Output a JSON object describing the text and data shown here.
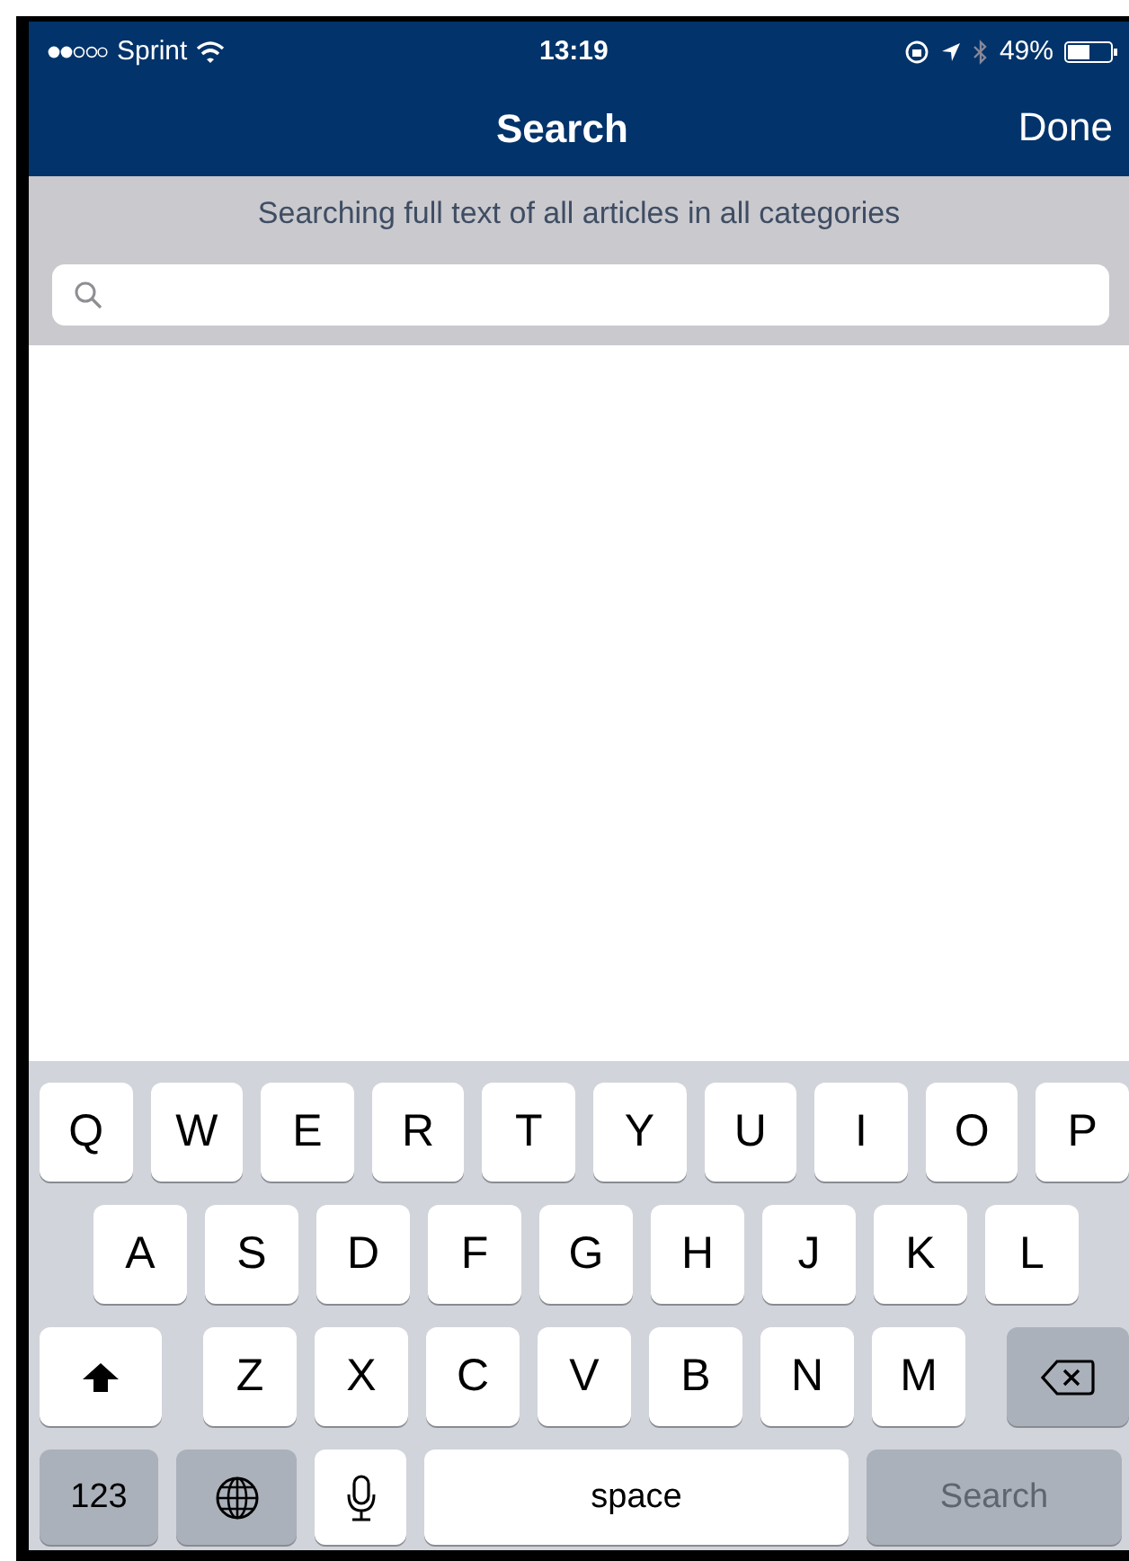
{
  "status_bar": {
    "carrier": "Sprint",
    "time": "13:19",
    "battery": "49%"
  },
  "nav_bar": {
    "title": "Search",
    "done": "Done"
  },
  "search_header": {
    "caption": "Searching full text of all articles in all categories"
  },
  "keyboard": {
    "rows": [
      {
        "keys": [
          {
            "kind": "letter",
            "label": "Q"
          },
          {
            "kind": "letter",
            "label": "W"
          },
          {
            "kind": "letter",
            "label": "E"
          },
          {
            "kind": "letter",
            "label": "R"
          },
          {
            "kind": "letter",
            "label": "T"
          },
          {
            "kind": "letter",
            "label": "Y"
          },
          {
            "kind": "letter",
            "label": "U"
          },
          {
            "kind": "letter",
            "label": "I"
          },
          {
            "kind": "letter",
            "label": "O"
          },
          {
            "kind": "letter",
            "label": "P"
          }
        ]
      },
      {
        "keys": [
          {
            "kind": "letter",
            "label": "A"
          },
          {
            "kind": "letter",
            "label": "S"
          },
          {
            "kind": "letter",
            "label": "D"
          },
          {
            "kind": "letter",
            "label": "F"
          },
          {
            "kind": "letter",
            "label": "G"
          },
          {
            "kind": "letter",
            "label": "H"
          },
          {
            "kind": "letter",
            "label": "J"
          },
          {
            "kind": "letter",
            "label": "K"
          },
          {
            "kind": "letter",
            "label": "L"
          }
        ]
      },
      {
        "keys": [
          {
            "kind": "shift"
          },
          {
            "kind": "letter",
            "label": "Z"
          },
          {
            "kind": "letter",
            "label": "X"
          },
          {
            "kind": "letter",
            "label": "C"
          },
          {
            "kind": "letter",
            "label": "V"
          },
          {
            "kind": "letter",
            "label": "B"
          },
          {
            "kind": "letter",
            "label": "N"
          },
          {
            "kind": "letter",
            "label": "M"
          },
          {
            "kind": "delete"
          }
        ]
      },
      {
        "keys": [
          {
            "kind": "numbers",
            "label": "123"
          },
          {
            "kind": "globe"
          },
          {
            "kind": "mic"
          },
          {
            "kind": "space",
            "label": "space"
          },
          {
            "kind": "action",
            "label": "Search",
            "disabled": true
          }
        ]
      }
    ]
  }
}
